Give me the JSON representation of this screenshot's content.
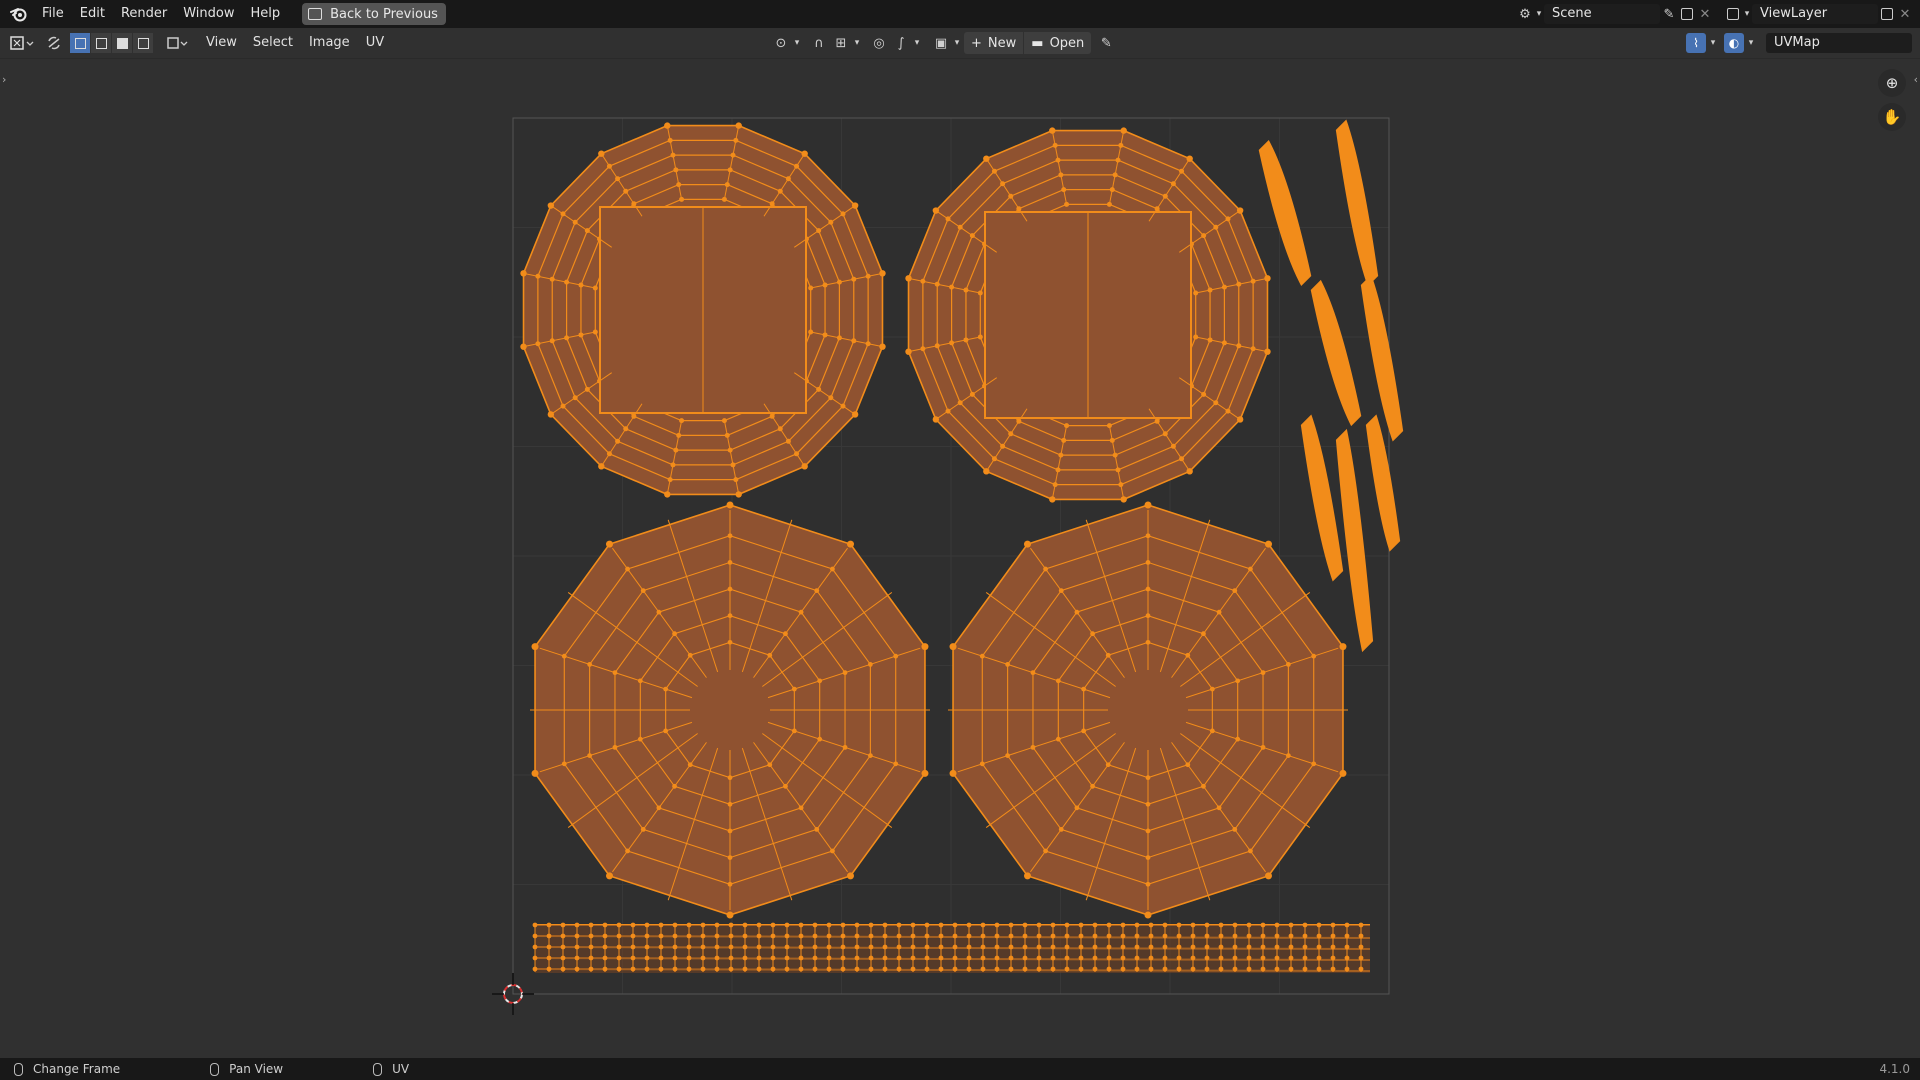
{
  "app": {
    "menu": [
      "File",
      "Edit",
      "Render",
      "Window",
      "Help"
    ],
    "back_button": "Back to Previous",
    "logo_icon": "blender-logo-icon"
  },
  "top_right": {
    "scene_name": "Scene",
    "view_layer_name": "ViewLayer"
  },
  "header": {
    "menus": [
      "View",
      "Select",
      "Image",
      "UV"
    ],
    "new_label": "New",
    "open_label": "Open",
    "uv_map": "UVMap",
    "select_modes": [
      "vertex",
      "edge",
      "face",
      "island"
    ],
    "active_select_mode": "vertex"
  },
  "viewport": {
    "uv_color": "#f28c1a",
    "uv_fill": "#8f5230",
    "background": "#303030"
  },
  "status": {
    "items": [
      "Change Frame",
      "Pan View",
      "UV"
    ],
    "version": "4.1.0"
  }
}
